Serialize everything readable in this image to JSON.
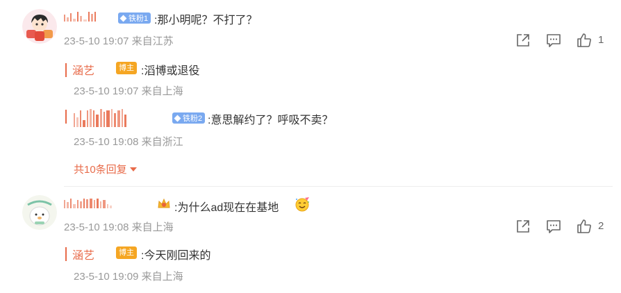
{
  "comments": [
    {
      "badge": "铁粉1",
      "text": ":那小明呢？不打了？",
      "meta": "23-5-10 19:07 来自江苏",
      "like_count": "1",
      "replies": [
        {
          "author": "涵艺",
          "host_badge": "博主",
          "text": ":滔博或退役",
          "meta": "23-5-10 19:07 来自上海"
        },
        {
          "badge": "铁粉2",
          "text": ":意思解约了？呼吸不卖？",
          "meta": "23-5-10 19:08 来自浙江"
        }
      ],
      "more_label": "共10条回复"
    },
    {
      "text": ":为什么ad现在在基地",
      "meta": "23-5-10 19:08 来自上海",
      "like_count": "2",
      "replies": [
        {
          "author": "涵艺",
          "host_badge": "博主",
          "text": ":今天刚回来的",
          "meta": "23-5-10 19:09 来自上海"
        }
      ]
    }
  ],
  "icons": [
    "share-icon",
    "comment-icon",
    "like-icon"
  ],
  "colors": {
    "accent": "#e86b4a",
    "meta": "#999999",
    "fan_badge": "#7aa9f0",
    "host_badge": "#f5a623"
  }
}
